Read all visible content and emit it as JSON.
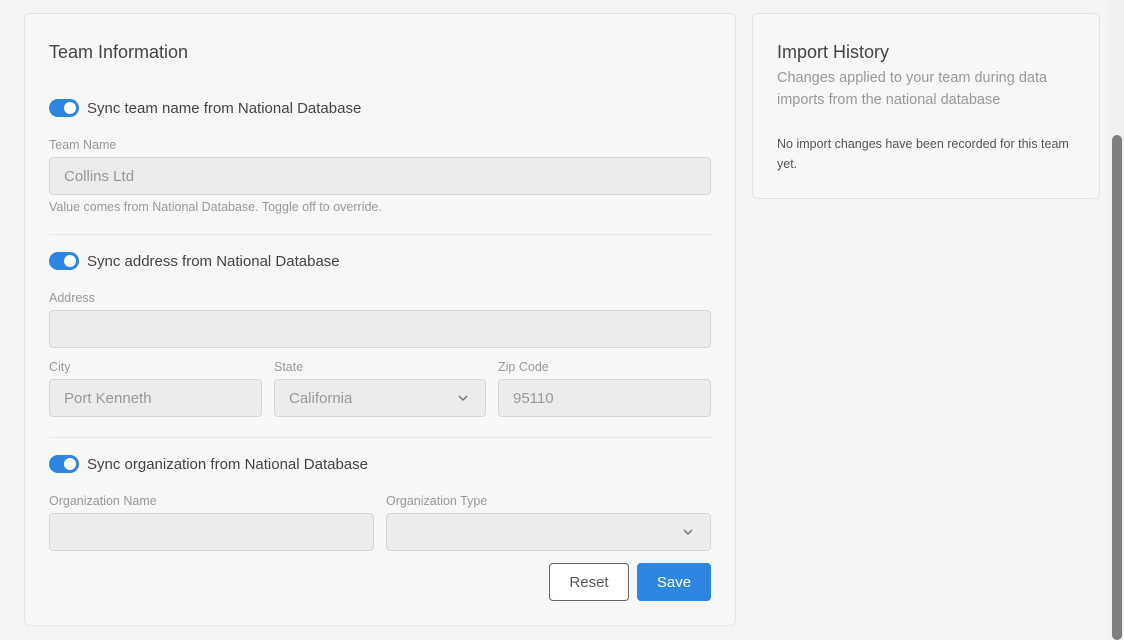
{
  "team_info": {
    "title": "Team Information",
    "sync_name": {
      "label": "Sync team name from National Database",
      "on": true
    },
    "team_name": {
      "label": "Team Name",
      "value": "Collins Ltd",
      "helper": "Value comes from National Database. Toggle off to override."
    },
    "sync_address": {
      "label": "Sync address from National Database",
      "on": true
    },
    "address": {
      "label": "Address",
      "value": ""
    },
    "city": {
      "label": "City",
      "value": "Port Kenneth"
    },
    "state": {
      "label": "State",
      "value": "California"
    },
    "zip": {
      "label": "Zip Code",
      "value": "95110"
    },
    "sync_org": {
      "label": "Sync organization from National Database",
      "on": true
    },
    "org_name": {
      "label": "Organization Name",
      "value": ""
    },
    "org_type": {
      "label": "Organization Type",
      "value": ""
    },
    "reset_label": "Reset",
    "save_label": "Save"
  },
  "import_history": {
    "title": "Import History",
    "subtitle": "Changes applied to your team during data imports from the national database",
    "empty": "No import changes have been recorded for this team yet."
  },
  "colors": {
    "accent": "#2f86e0"
  }
}
